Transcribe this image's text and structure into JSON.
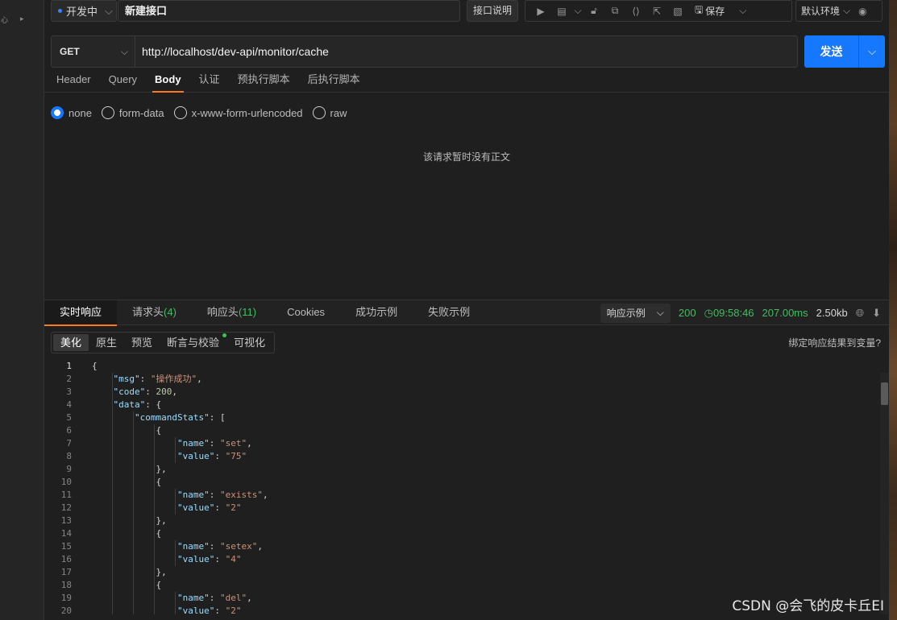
{
  "left_rail": {
    "glyph_a": "心",
    "glyph_b": "▸"
  },
  "top_bar": {
    "status_label": "开发中",
    "api_name": "新建接口",
    "doc_button": "接口说明",
    "save_label": "保存",
    "environment": "默认环境"
  },
  "request": {
    "method": "GET",
    "url": "http://localhost/dev-api/monitor/cache",
    "send_label": "发送"
  },
  "request_tabs": [
    "Header",
    "Query",
    "Body",
    "认证",
    "预执行脚本",
    "后执行脚本"
  ],
  "body_options": [
    "none",
    "form-data",
    "x-www-form-urlencoded",
    "raw"
  ],
  "body_empty_message": "该请求暂时没有正文",
  "response_tabs": {
    "live": "实时响应",
    "req_headers": "请求头",
    "req_headers_count": "(4)",
    "resp_headers": "响应头",
    "resp_headers_count": "(11)",
    "cookies": "Cookies",
    "success_example": "成功示例",
    "fail_example": "失败示例"
  },
  "response_meta": {
    "example_select": "响应示例",
    "status_code": "200",
    "time": "09:58:46",
    "duration": "207.00ms",
    "size": "2.50kb"
  },
  "view_tabs": [
    "美化",
    "原生",
    "预览",
    "断言与校验",
    "可视化"
  ],
  "bind_link": "绑定响应结果到变量?",
  "code_lines": [
    {
      "ln": "1",
      "tokens": [
        [
          "p",
          "{"
        ]
      ]
    },
    {
      "ln": "2",
      "tokens": [
        [
          "p",
          "    "
        ],
        [
          "s",
          "\"msg\""
        ],
        [
          "p",
          ": "
        ],
        [
          "s",
          "\"操作成功\""
        ],
        [
          "p",
          ","
        ]
      ]
    },
    {
      "ln": "3",
      "tokens": [
        [
          "p",
          "    "
        ],
        [
          "s",
          "\"code\""
        ],
        [
          "p",
          ": "
        ],
        [
          "n",
          "200"
        ],
        [
          "p",
          ","
        ]
      ]
    },
    {
      "ln": "4",
      "tokens": [
        [
          "p",
          "    "
        ],
        [
          "s",
          "\"data\""
        ],
        [
          "p",
          ": {"
        ]
      ]
    },
    {
      "ln": "5",
      "tokens": [
        [
          "p",
          "        "
        ],
        [
          "s",
          "\"commandStats\""
        ],
        [
          "p",
          ": ["
        ]
      ]
    },
    {
      "ln": "6",
      "tokens": [
        [
          "p",
          "            {"
        ]
      ]
    },
    {
      "ln": "7",
      "tokens": [
        [
          "p",
          "                "
        ],
        [
          "s",
          "\"name\""
        ],
        [
          "p",
          ": "
        ],
        [
          "s",
          "\"set\""
        ],
        [
          "p",
          ","
        ]
      ]
    },
    {
      "ln": "8",
      "tokens": [
        [
          "p",
          "                "
        ],
        [
          "s",
          "\"value\""
        ],
        [
          "p",
          ": "
        ],
        [
          "s",
          "\"75\""
        ]
      ]
    },
    {
      "ln": "9",
      "tokens": [
        [
          "p",
          "            },"
        ]
      ]
    },
    {
      "ln": "10",
      "tokens": [
        [
          "p",
          "            {"
        ]
      ]
    },
    {
      "ln": "11",
      "tokens": [
        [
          "p",
          "                "
        ],
        [
          "s",
          "\"name\""
        ],
        [
          "p",
          ": "
        ],
        [
          "s",
          "\"exists\""
        ],
        [
          "p",
          ","
        ]
      ]
    },
    {
      "ln": "12",
      "tokens": [
        [
          "p",
          "                "
        ],
        [
          "s",
          "\"value\""
        ],
        [
          "p",
          ": "
        ],
        [
          "s",
          "\"2\""
        ]
      ]
    },
    {
      "ln": "13",
      "tokens": [
        [
          "p",
          "            },"
        ]
      ]
    },
    {
      "ln": "14",
      "tokens": [
        [
          "p",
          "            {"
        ]
      ]
    },
    {
      "ln": "15",
      "tokens": [
        [
          "p",
          "                "
        ],
        [
          "s",
          "\"name\""
        ],
        [
          "p",
          ": "
        ],
        [
          "s",
          "\"setex\""
        ],
        [
          "p",
          ","
        ]
      ]
    },
    {
      "ln": "16",
      "tokens": [
        [
          "p",
          "                "
        ],
        [
          "s",
          "\"value\""
        ],
        [
          "p",
          ": "
        ],
        [
          "s",
          "\"4\""
        ]
      ]
    },
    {
      "ln": "17",
      "tokens": [
        [
          "p",
          "            },"
        ]
      ]
    },
    {
      "ln": "18",
      "tokens": [
        [
          "p",
          "            {"
        ]
      ]
    },
    {
      "ln": "19",
      "tokens": [
        [
          "p",
          "                "
        ],
        [
          "s",
          "\"name\""
        ],
        [
          "p",
          ": "
        ],
        [
          "s",
          "\"del\""
        ],
        [
          "p",
          ","
        ]
      ]
    },
    {
      "ln": "20",
      "tokens": [
        [
          "p",
          "                "
        ],
        [
          "s",
          "\"value\""
        ],
        [
          "p",
          ": "
        ],
        [
          "s",
          "\"2\""
        ]
      ]
    }
  ],
  "watermark": "CSDN @会飞的皮卡丘EI",
  "colors": {
    "accent": "#1677ff",
    "tab_underline": "#ff7a1a",
    "success": "#3fbf5f"
  },
  "icons": [
    "run-icon",
    "mock-icon",
    "lock-icon",
    "copy-icon",
    "code-icon",
    "share-icon",
    "history-icon",
    "save-icon",
    "eye-icon",
    "globe-icon",
    "download-icon",
    "clock-icon"
  ]
}
